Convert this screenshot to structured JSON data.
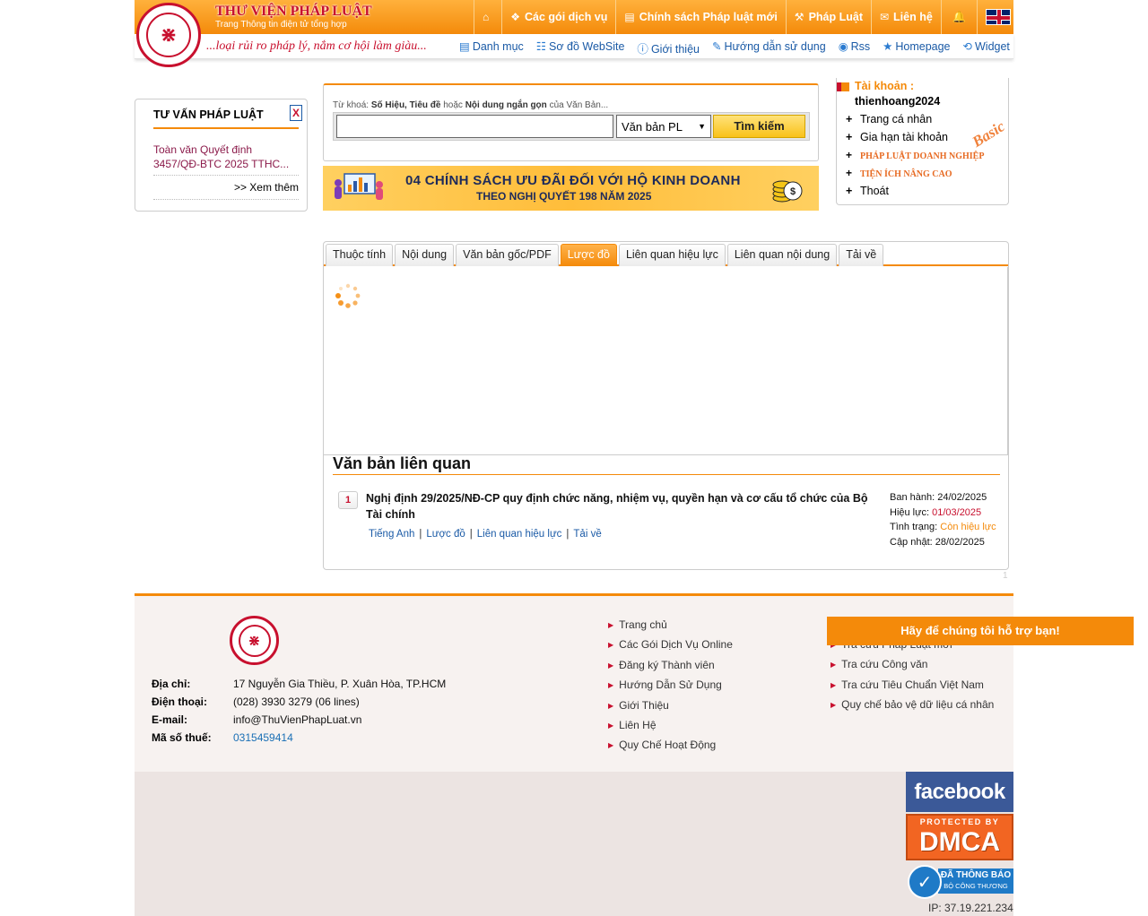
{
  "header": {
    "brand_title": "THƯ VIỆN PHÁP LUẬT",
    "brand_subtitle": "Trang Thông tin điện tử tổng hợp",
    "slogan": "...loại rủi ro pháp lý, nắm cơ hội làm giàu...",
    "top_nav": [
      {
        "label": "",
        "icon": "home-icon"
      },
      {
        "label": "Các gói dịch vụ",
        "icon": "dropbox-icon"
      },
      {
        "label": "Chính sách Pháp luật mới",
        "icon": "newspaper-icon"
      },
      {
        "label": "Pháp Luật",
        "icon": "gavel-icon"
      },
      {
        "label": "Liên hệ",
        "icon": "envelope-icon"
      },
      {
        "label": "",
        "icon": "bell-icon"
      }
    ],
    "sub_nav": [
      {
        "label": "Danh mục",
        "icon": "list-icon"
      },
      {
        "label": "Sơ đồ WebSite",
        "icon": "sitemap-icon"
      },
      {
        "label": "Giới thiệu",
        "icon": "info-icon"
      },
      {
        "label": "Hướng dẫn sử dụng",
        "icon": "book-icon"
      },
      {
        "label": "Rss",
        "icon": "rss-icon"
      },
      {
        "label": "Homepage",
        "icon": "star-icon"
      },
      {
        "label": "Widget",
        "icon": "share-icon"
      }
    ]
  },
  "left_box": {
    "title": "TƯ VẤN PHÁP LUẬT",
    "close_label": "X",
    "link_text": "Toàn văn Quyết định 3457/QĐ-BTC 2025 TTHC...",
    "more_label": ">> Xem thêm"
  },
  "search": {
    "hint_prefix": "Từ khoá:",
    "hint_b1": "Số Hiệu, Tiêu đề",
    "hint_mid": "hoặc",
    "hint_b2": "Nội dung ngắn gọn",
    "hint_suffix": "của Văn Bản...",
    "input_value": "",
    "select_value": "Văn bản PL",
    "button_label": "Tìm kiếm"
  },
  "banner": {
    "line1": "04 CHÍNH SÁCH ƯU ĐÃI ĐỐI VỚI HỘ KINH DOANH",
    "line2": "THEO NGHỊ QUYẾT 198 NĂM 2025"
  },
  "account": {
    "label": "Tài khoản :",
    "username": "thienhoang2024",
    "plan_badge": "Basic",
    "menu": [
      "Trang cá nhân",
      "Gia hạn tài khoản",
      "PHÁP LUẬT DOANH NGHIỆP",
      "TIỆN ÍCH NÂNG CAO",
      "Thoát"
    ]
  },
  "tabs": {
    "items": [
      "Thuộc tính",
      "Nội dung",
      "Văn bản gốc/PDF",
      "Lược đồ",
      "Liên quan hiệu lực",
      "Liên quan nội dung",
      "Tải về"
    ],
    "active_index": 3
  },
  "related": {
    "section_title": "Văn bản liên quan",
    "items": [
      {
        "number": "1",
        "title": "Nghị định 29/2025/NĐ-CP quy định chức năng, nhiệm vụ, quyền hạn và cơ cấu tổ chức của Bộ Tài chính",
        "links": [
          "Tiếng Anh",
          "Lược đồ",
          "Liên quan hiệu lực",
          "Tải về"
        ],
        "issued_label": "Ban hành:",
        "issued": "24/02/2025",
        "effective_label": "Hiệu lực:",
        "effective": "01/03/2025",
        "status_label": "Tình trạng:",
        "status": "Còn hiệu lực",
        "updated_label": "Cập nhật:",
        "updated": "28/02/2025"
      }
    ],
    "page_number": "1"
  },
  "footer": {
    "info": [
      {
        "key": "Địa chỉ:",
        "value": "17 Nguyễn Gia Thiều, P. Xuân Hòa, TP.HCM"
      },
      {
        "key": "Điện thoại:",
        "value": "(028) 3930 3279 (06 lines)"
      },
      {
        "key": "E-mail:",
        "value": "info@ThuVienPhapLuat.vn"
      },
      {
        "key": "Mã số thuế:",
        "value": "0315459414"
      }
    ],
    "col1": [
      "Trang chủ",
      "Các Gói Dịch Vụ Online",
      "Đăng ký Thành viên",
      "Hướng Dẫn Sử Dụng",
      "Giới Thiệu",
      "Liên Hệ",
      "Quy Chế Hoạt Động"
    ],
    "col2": [
      "Tra cứu Pháp Luật mới",
      "Tra cứu Công văn",
      "Tra cứu Tiêu Chuẩn Việt Nam",
      "Quy chế bảo vệ dữ liệu cá nhân"
    ],
    "support_label": "Hãy để chúng tôi hỗ trợ bạn!"
  },
  "badges": {
    "facebook": "facebook",
    "dmca_top": "PROTECTED BY",
    "dmca_main": "DMCA",
    "bct_line1": "ĐÃ THÔNG BÁO",
    "bct_line2": "BỘ CÔNG THƯƠNG",
    "ip": "IP: 37.19.221.234"
  },
  "colors": {
    "accent_orange": "#f48a0a",
    "brand_red": "#c8102e",
    "link_blue": "#1a5aa6"
  }
}
